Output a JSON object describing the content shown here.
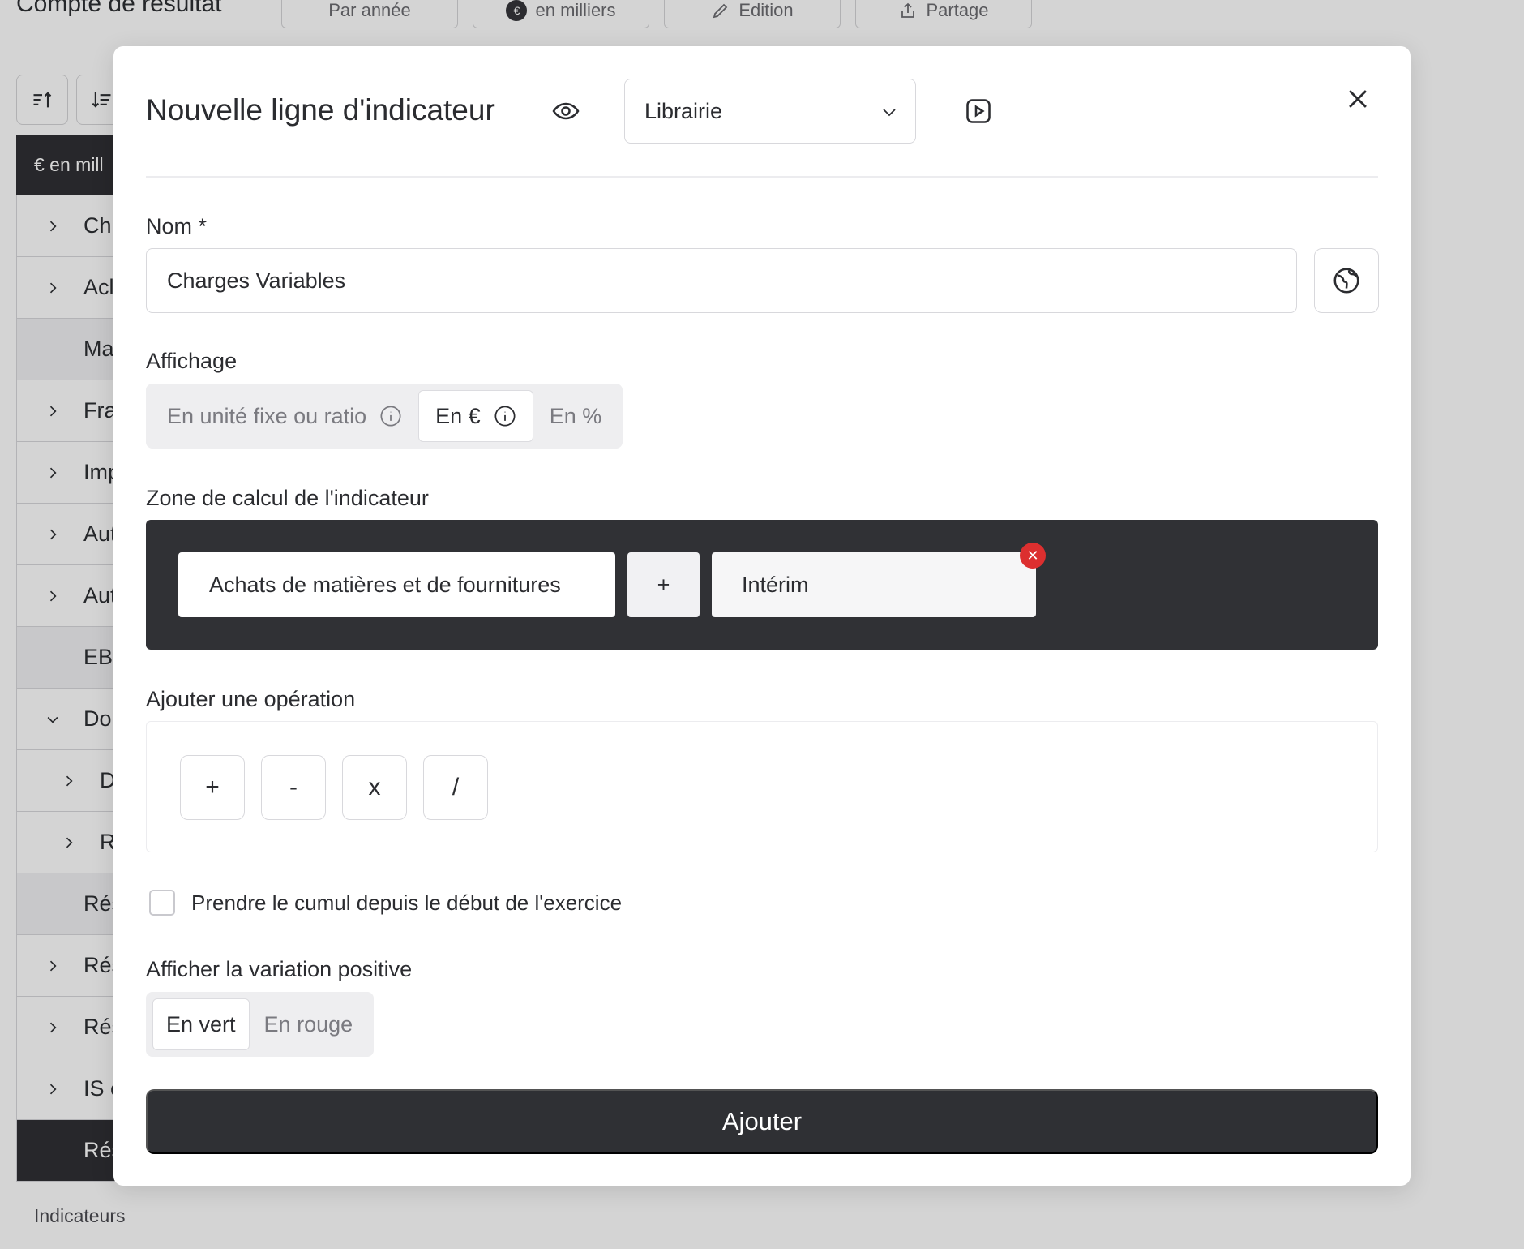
{
  "background": {
    "page_title": "Compte de résultat",
    "top_buttons": {
      "period": "Par année",
      "unit": "en milliers",
      "unit_coin": "€",
      "edit": "Edition",
      "share": "Partage"
    },
    "table_header": "€ en mill",
    "rows": [
      {
        "label": "Ch"
      },
      {
        "label": "Acl"
      },
      {
        "label": "Ma"
      },
      {
        "label": "Fra"
      },
      {
        "label": "Imp"
      },
      {
        "label": "Aut"
      },
      {
        "label": "Aut"
      },
      {
        "label": "EB"
      },
      {
        "label": "Do"
      },
      {
        "label": "D"
      },
      {
        "label": "R"
      },
      {
        "label": "Rés"
      },
      {
        "label": "Rés"
      },
      {
        "label": "Rés"
      },
      {
        "label": "IS e"
      },
      {
        "label": "Rés"
      }
    ],
    "footer_label": "Indicateurs"
  },
  "modal": {
    "title": "Nouvelle ligne d'indicateur",
    "selected_template": "Librairie",
    "name_label": "Nom *",
    "name_value": "Charges Variables",
    "display_label": "Affichage",
    "display_options": [
      "En unité fixe ou ratio",
      "En €",
      "En %"
    ],
    "display_selected": "En €",
    "calc_zone_label": "Zone de calcul de l'indicateur",
    "formula": {
      "item_1": "Achats de matières et de fournitures",
      "operator": "+",
      "item_2": "Intérim",
      "remove_glyph": "✕"
    },
    "operations_label": "Ajouter une opération",
    "operations": [
      "+",
      "-",
      "x",
      "/"
    ],
    "cumul_label": "Prendre le cumul depuis le début de l'exercice",
    "cumul_checked": false,
    "variation_label": "Afficher la variation positive",
    "variation_options": [
      "En vert",
      "En rouge"
    ],
    "variation_selected": "En vert",
    "submit_label": "Ajouter"
  },
  "colors": {
    "dark": "#2f3034",
    "remove_red": "#dc2f2f",
    "segment_bg": "#eeeef0"
  }
}
